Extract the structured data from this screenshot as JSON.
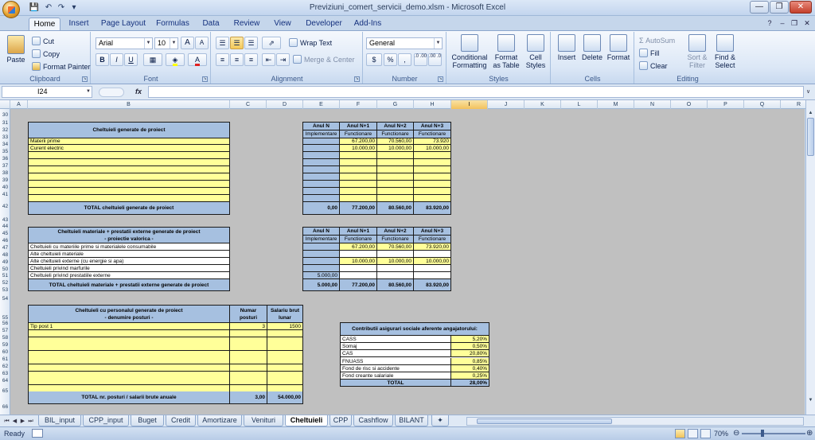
{
  "window": {
    "title": "Previziuni_comert_servicii_demo.xlsm - Microsoft Excel",
    "qat": [
      "save",
      "undo",
      "redo"
    ]
  },
  "tabs": [
    "Home",
    "Insert",
    "Page Layout",
    "Formulas",
    "Data",
    "Review",
    "View",
    "Developer",
    "Add-Ins"
  ],
  "ribbon": {
    "clipboard": {
      "label": "Clipboard",
      "paste": "Paste",
      "cut": "Cut",
      "copy": "Copy",
      "format_painter": "Format Painter"
    },
    "font": {
      "label": "Font",
      "name": "Arial",
      "size": "10",
      "bold": "B",
      "italic": "I",
      "underline": "U",
      "grow": "A",
      "shrink": "A",
      "font_color": "A"
    },
    "alignment": {
      "label": "Alignment",
      "wrap": "Wrap Text",
      "merge": "Merge & Center"
    },
    "number": {
      "label": "Number",
      "format": "General",
      "currency": "$",
      "percent": "%",
      "comma": ",",
      "inc_dec": ".0 .00",
      "dec_dec": ".00 .0"
    },
    "styles": {
      "label": "Styles",
      "cond": [
        "Conditional",
        "Formatting"
      ],
      "table": [
        "Format",
        "as Table"
      ],
      "cell": [
        "Cell",
        "Styles"
      ]
    },
    "cells": {
      "label": "Cells",
      "insert": "Insert",
      "delete": "Delete",
      "format": "Format"
    },
    "editing": {
      "label": "Editing",
      "autosum": "AutoSum",
      "fill": "Fill",
      "clear": "Clear",
      "sort": [
        "Sort &",
        "Filter"
      ],
      "find": [
        "Find &",
        "Select"
      ]
    }
  },
  "formula_bar": {
    "name_box": "I24",
    "fx": "fx",
    "value": ""
  },
  "columns": [
    "A",
    "B",
    "C",
    "D",
    "E",
    "F",
    "G",
    "H",
    "I",
    "J",
    "K",
    "L",
    "M",
    "N",
    "O",
    "P",
    "Q",
    "R"
  ],
  "rows": [
    "30",
    "31",
    "32",
    "33",
    "34",
    "35",
    "36",
    "37",
    "38",
    "39",
    "40",
    "41",
    "42",
    "43",
    "44",
    "45",
    "46",
    "47",
    "48",
    "49",
    "50",
    "51",
    "52",
    "53",
    "54",
    "55",
    "56",
    "57",
    "58",
    "59",
    "60",
    "61",
    "62",
    "63",
    "64",
    "65",
    "66"
  ],
  "sheet": {
    "t1": {
      "title": "Cheltuieli generate de proiect",
      "items": [
        "Materii prime",
        "Curent electric"
      ],
      "total_label": "TOTAL cheltuieli  generate de proiect",
      "years": [
        "Anul N",
        "Anul N+1",
        "Anul N+2",
        "Anul N+3"
      ],
      "phases": [
        "Implementare",
        "Functionare",
        "Functionare",
        "Functionare"
      ],
      "values": [
        [
          "",
          "67.200,00",
          "70.560,00",
          "73.920"
        ],
        [
          "",
          "10.000,00",
          "10.000,00",
          "10.000,00"
        ]
      ],
      "totals": [
        "0,00",
        "77.200,00",
        "80.560,00",
        "83.920,00"
      ]
    },
    "t2": {
      "title": "Cheltuieli materiale + prestatii externe generate de proiect",
      "subtitle": "- proiectie valorica -",
      "items": [
        "Cheltuieli cu materiile prime si materialele consumabile",
        "Alte cheltuieli materiale",
        "Alte cheltuieli externe (cu energie si apa)",
        "Cheltuieli privind marfurile",
        "Cheltuieli privind prestatiile externe"
      ],
      "total_label": "TOTAL cheltuieli materiale + prestatii externe generate de proiect",
      "years": [
        "Anul N",
        "Anul N+1",
        "Anul N+2",
        "Anul N+3"
      ],
      "phases": [
        "Implementare",
        "Functionare",
        "Functionare",
        "Functionare"
      ],
      "values": [
        [
          "",
          "67.200,00",
          "70.560,00",
          "73.920,00"
        ],
        [
          "",
          "",
          "",
          ""
        ],
        [
          "",
          "10.000,00",
          "10.000,00",
          "10.000,00"
        ],
        [
          "",
          "",
          "",
          ""
        ],
        [
          "5.000,00",
          "",
          "",
          ""
        ]
      ],
      "totals": [
        "5.000,00",
        "77.200,00",
        "80.560,00",
        "83.920,00"
      ]
    },
    "t3": {
      "title": "Cheltuieli cu personalul generate de proiect",
      "subtitle": "- denumire posturi -",
      "col_num": [
        "Numar",
        "posturi"
      ],
      "col_sal": [
        "Salariu brut",
        "lunar"
      ],
      "row1": {
        "name": "Tip post 1",
        "num": "3",
        "sal": "1500"
      },
      "total_label": "TOTAL nr. posturi / salarii brute anuale",
      "total_num": "3,00",
      "total_sal": "54.000,00"
    },
    "t4": {
      "title": "Contributii asigurari sociale aferente angajatorului:",
      "rows": [
        {
          "name": "CASS",
          "val": "5,20%"
        },
        {
          "name": "Somaj",
          "val": "0,50%"
        },
        {
          "name": "CAS",
          "val": "20,80%"
        },
        {
          "name": "FNUASS",
          "val": "0,85%"
        },
        {
          "name": "Fond de risc si accidente",
          "val": "0,40%"
        },
        {
          "name": "Fond creante salariale",
          "val": "0,25%"
        }
      ],
      "total_label": "TOTAL",
      "total_val": "28,00%"
    }
  },
  "sheet_tabs": [
    "BIL_input",
    "CPP_input",
    "Buget",
    "Credit",
    "Amortizare",
    "Venituri",
    "Cheltuieli",
    "CPP",
    "Cashflow",
    "BILANT"
  ],
  "active_sheet": "Cheltuieli",
  "status": {
    "ready": "Ready",
    "zoom": "70%"
  }
}
